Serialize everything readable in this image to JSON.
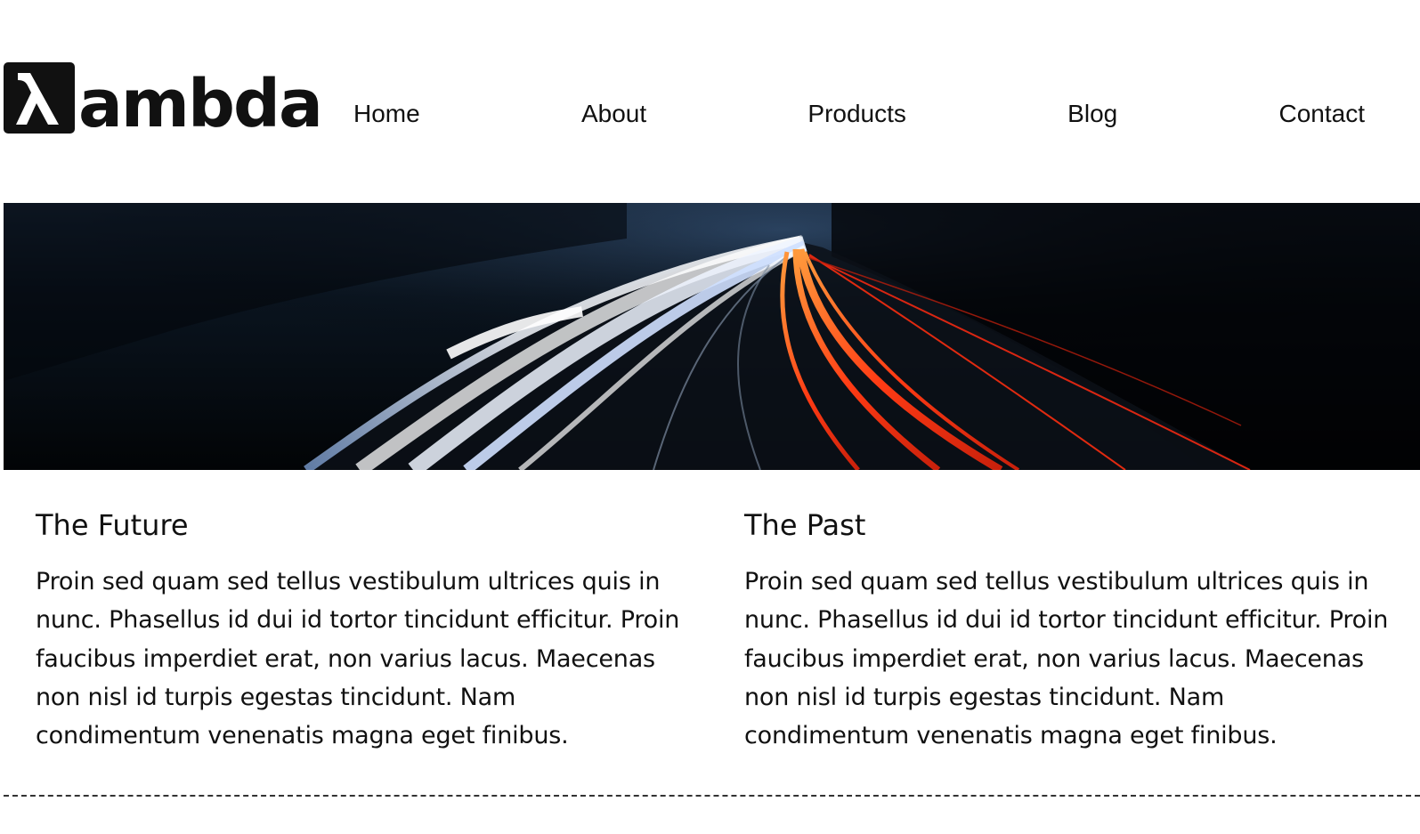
{
  "brand": {
    "logo_mark": "λ",
    "logo_text": "ambda"
  },
  "nav": {
    "items": [
      {
        "label": "Home"
      },
      {
        "label": "About"
      },
      {
        "label": "Products"
      },
      {
        "label": "Blog"
      },
      {
        "label": "Contact"
      }
    ]
  },
  "hero": {
    "image_subject": "long-exposure highway light trails at night"
  },
  "columns": [
    {
      "title": "The Future",
      "body": "Proin sed quam sed tellus vestibulum ultrices quis in nunc. Phasellus id dui id tortor tincidunt efficitur. Proin faucibus imperdiet erat, non varius lacus. Maecenas non nisl id turpis egestas tincidunt. Nam condimentum venenatis magna eget finibus."
    },
    {
      "title": "The Past",
      "body": "Proin sed quam sed tellus vestibulum ultrices quis in nunc. Phasellus id dui id tortor tincidunt efficitur. Proin faucibus imperdiet erat, non varius lacus. Maecenas non nisl id turpis egestas tincidunt. Nam condimentum venenatis magna eget finibus."
    }
  ],
  "colors": {
    "text": "#111111",
    "background": "#ffffff",
    "hero_dark": "#05080c",
    "trail_white": "#e8f1ff",
    "trail_red": "#ff4a1c"
  }
}
